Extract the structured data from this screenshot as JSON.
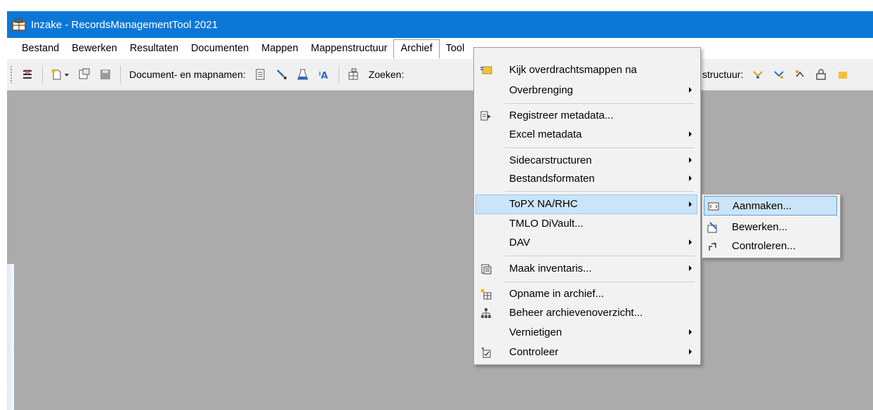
{
  "window": {
    "title": "Inzake - RecordsManagementTool 2021"
  },
  "menubar": {
    "items": [
      "Bestand",
      "Bewerken",
      "Resultaten",
      "Documenten",
      "Mappen",
      "Mappenstructuur",
      "Archief",
      "Tool"
    ],
    "active": "Archief"
  },
  "toolbar": {
    "document_names_label": "Document- en mapnamen:",
    "search_label": "Zoeken:",
    "structure_label": "structuur:"
  },
  "archief_menu": {
    "items": [
      {
        "label": "Kijk overdrachtsmappen na",
        "icon": "folder-check-icon"
      },
      {
        "label": "Overbrenging",
        "submenu": true
      },
      {
        "label": "Registreer metadata...",
        "icon": "register-metadata-icon"
      },
      {
        "label": "Excel metadata",
        "submenu": true
      },
      {
        "label": "Sidecarstructuren",
        "submenu": true
      },
      {
        "label": "Bestandsformaten",
        "submenu": true
      },
      {
        "label": "ToPX NA/RHC",
        "submenu": true,
        "highlighted": true
      },
      {
        "label": "TMLO DiVault..."
      },
      {
        "label": "DAV",
        "submenu": true
      },
      {
        "label": "Maak inventaris...",
        "submenu": true,
        "icon": "inventory-icon"
      },
      {
        "label": "Opname in archief...",
        "icon": "add-archive-icon"
      },
      {
        "label": "Beheer archievenoverzicht...",
        "icon": "archive-tree-icon"
      },
      {
        "label": "Vernietigen",
        "submenu": true
      },
      {
        "label": "Controleer",
        "submenu": true,
        "icon": "check-icon"
      }
    ]
  },
  "topx_submenu": {
    "items": [
      {
        "label": "Aanmaken...",
        "icon": "create-icon",
        "highlighted": true
      },
      {
        "label": "Bewerken...",
        "icon": "edit-icon"
      },
      {
        "label": "Controleren...",
        "icon": "validate-icon"
      }
    ]
  },
  "colors": {
    "titlebar": "#0b78d7",
    "highlight": "#cce4f7",
    "workspace": "#ababab"
  }
}
